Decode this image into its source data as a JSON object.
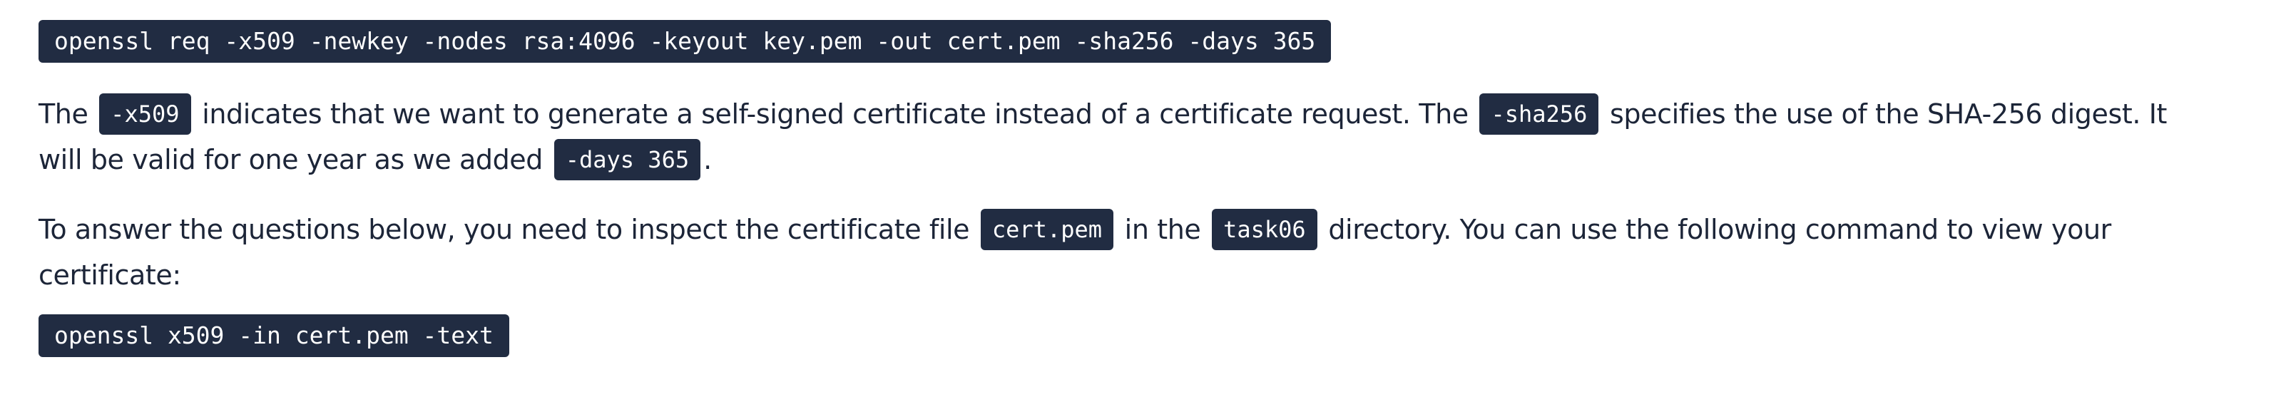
{
  "command_1": "openssl req -x509 -newkey -nodes rsa:4096 -keyout key.pem -out cert.pem -sha256 -days 365",
  "paragraph_1": {
    "t1": "The",
    "c1": "-x509",
    "t2": "indicates that we want to generate a self-signed certificate instead of a certificate request. The",
    "c2": "-sha256",
    "t3": "specifies the use of the SHA-256 digest. It",
    "t4": "will be valid for one year as we added",
    "c3": "-days 365",
    "t5": "."
  },
  "paragraph_2": {
    "t1": "To answer the questions below, you need to inspect the certificate file",
    "c1": "cert.pem",
    "t2": "in the",
    "c2": "task06",
    "t3": "directory. You can use the following command to view your",
    "t4": "certificate:"
  },
  "command_2": "openssl x509 -in cert.pem -text"
}
